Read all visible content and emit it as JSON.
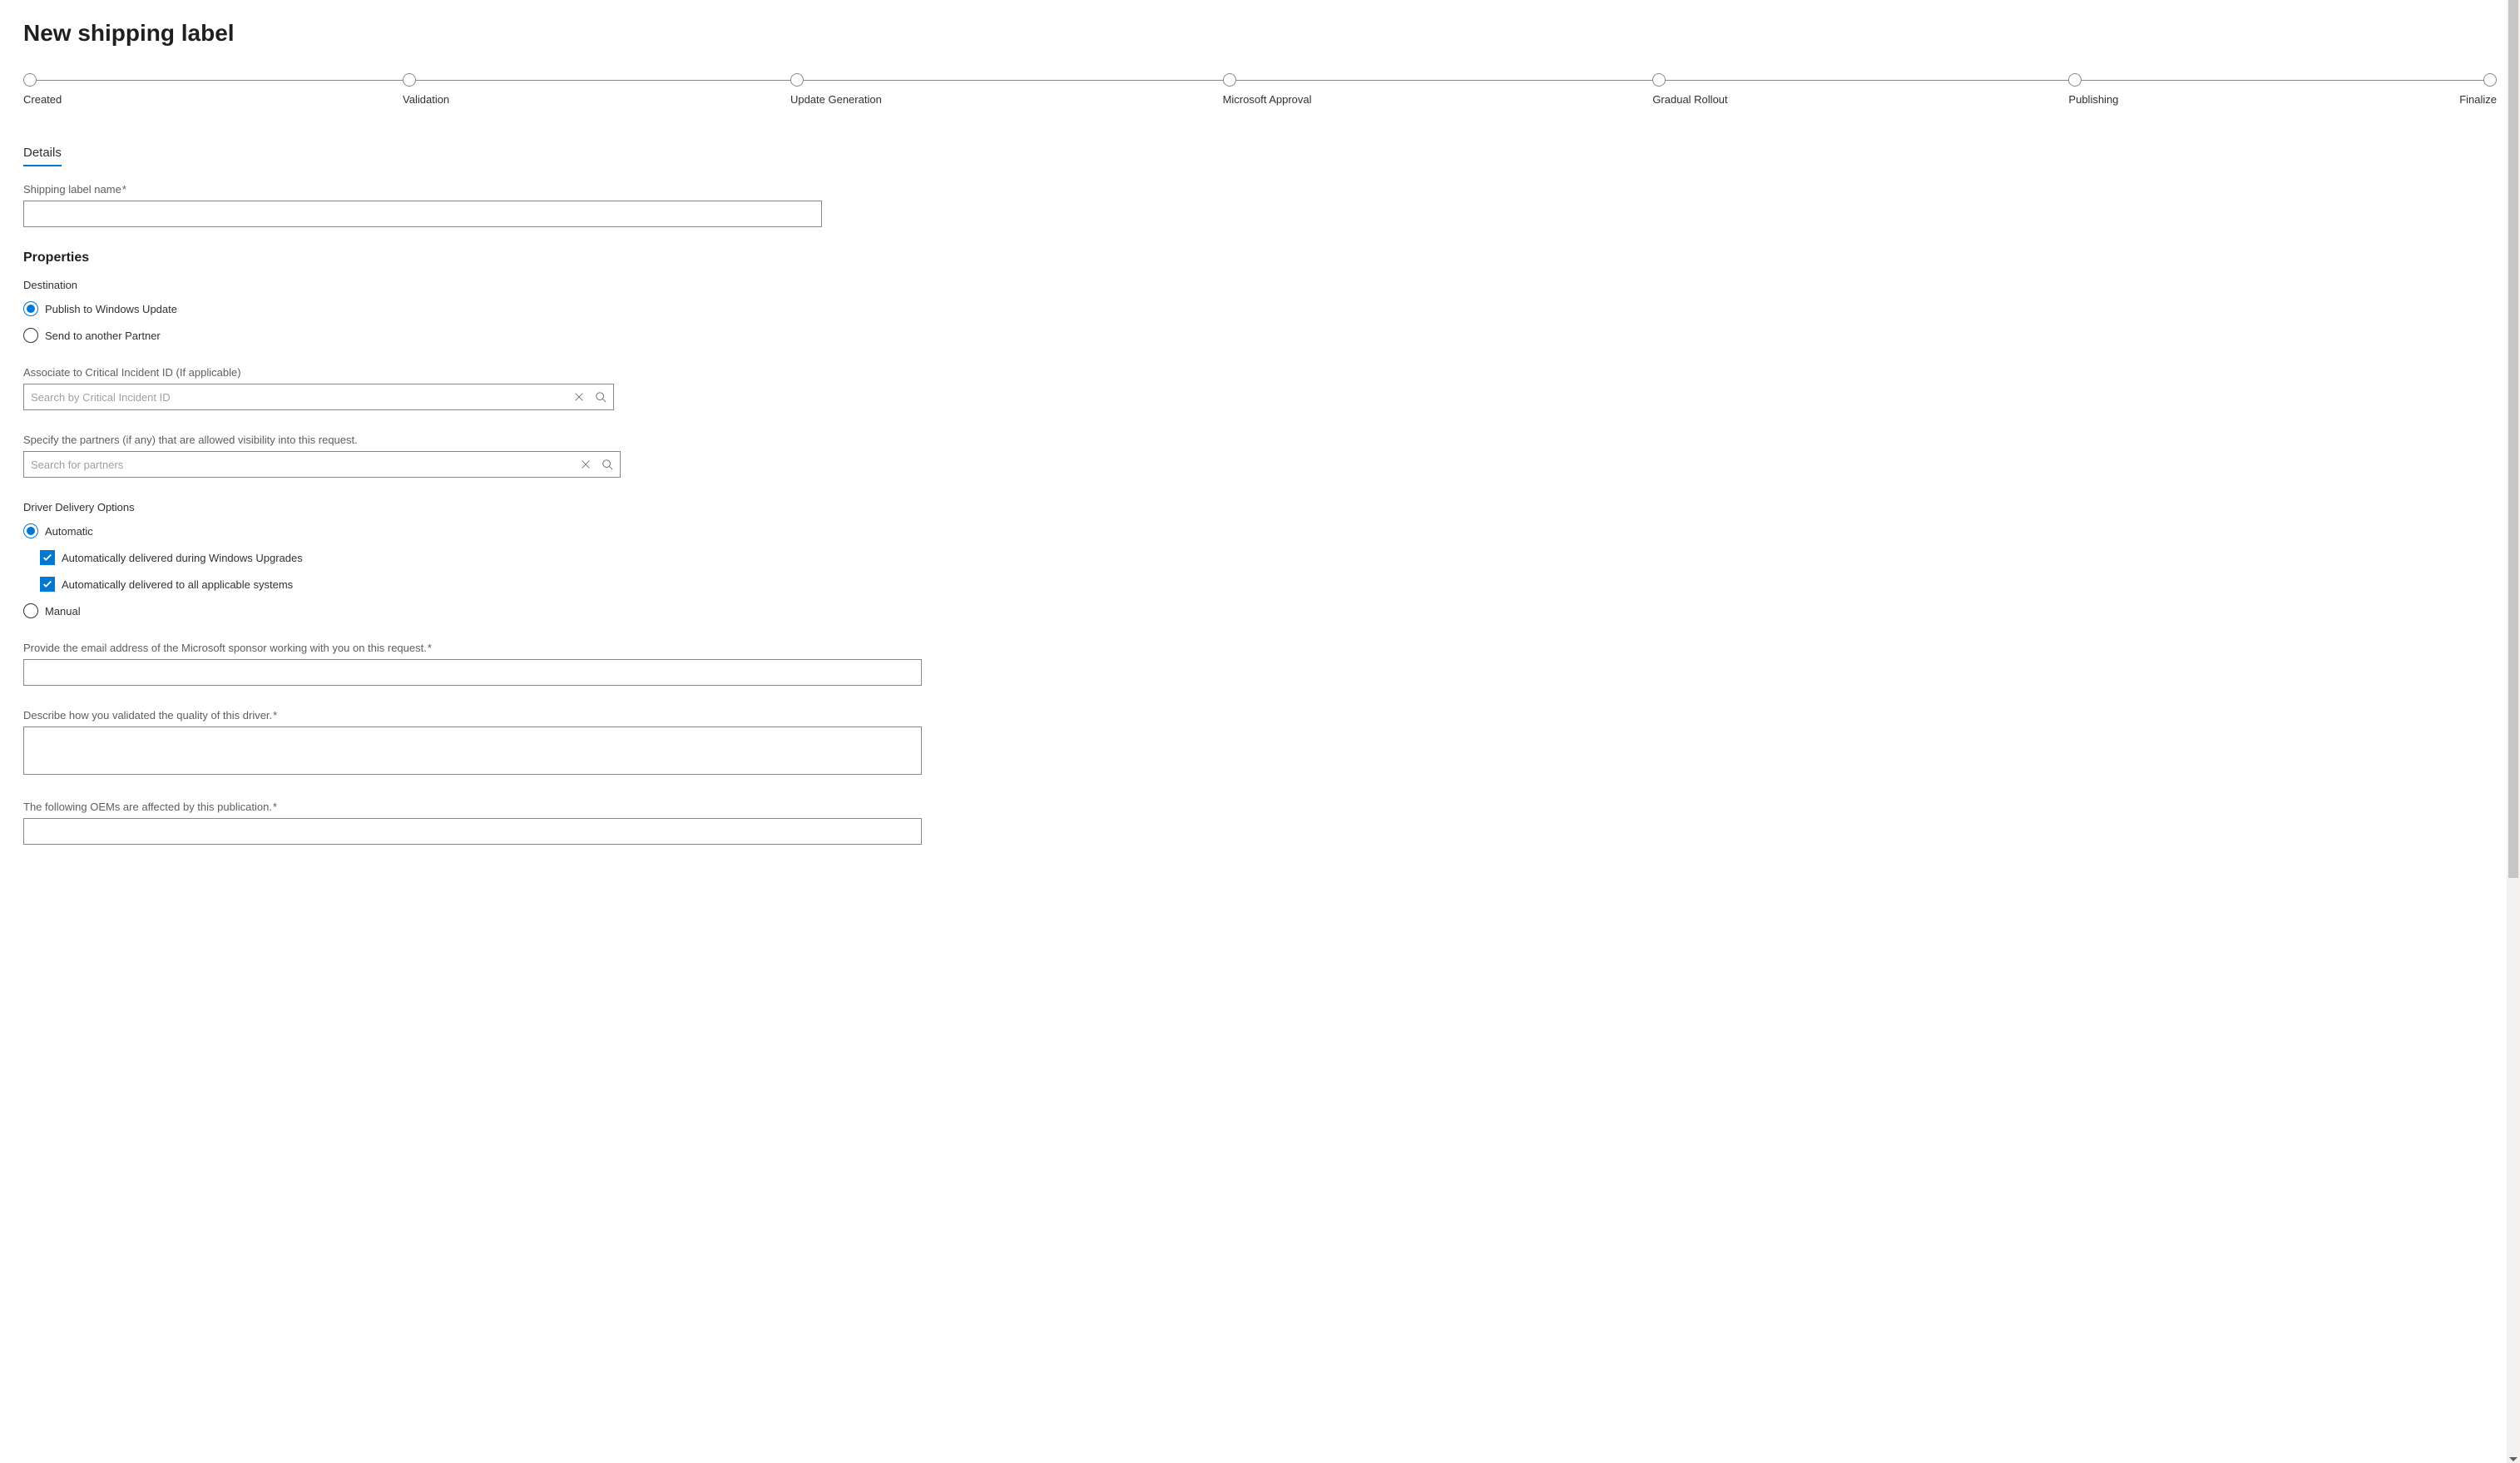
{
  "page": {
    "title": "New shipping label"
  },
  "stepper": {
    "steps": [
      {
        "label": "Created"
      },
      {
        "label": "Validation"
      },
      {
        "label": "Update Generation"
      },
      {
        "label": "Microsoft Approval"
      },
      {
        "label": "Gradual Rollout"
      },
      {
        "label": "Publishing"
      },
      {
        "label": "Finalize"
      }
    ]
  },
  "tabs": {
    "details": "Details"
  },
  "form": {
    "shipping_label_name": {
      "label": "Shipping label name",
      "value": ""
    },
    "properties_heading": "Properties",
    "destination": {
      "label": "Destination",
      "options": {
        "publish": "Publish to Windows Update",
        "send": "Send to another Partner"
      }
    },
    "critical_incident": {
      "label": "Associate to Critical Incident ID (If applicable)",
      "placeholder": "Search by Critical Incident ID"
    },
    "partners_visibility": {
      "label": "Specify the partners (if any) that are allowed visibility into this request.",
      "placeholder": "Search for partners"
    },
    "driver_delivery": {
      "label": "Driver Delivery Options",
      "automatic": "Automatic",
      "auto_upgrades": "Automatically delivered during Windows Upgrades",
      "auto_systems": "Automatically delivered to all applicable systems",
      "manual": "Manual"
    },
    "sponsor_email": {
      "label": "Provide the email address of the Microsoft sponsor working with you on this request.",
      "value": ""
    },
    "validation_desc": {
      "label": "Describe how you validated the quality of this driver.",
      "value": ""
    },
    "oems_affected": {
      "label": "The following OEMs are affected by this publication.",
      "value": ""
    }
  }
}
